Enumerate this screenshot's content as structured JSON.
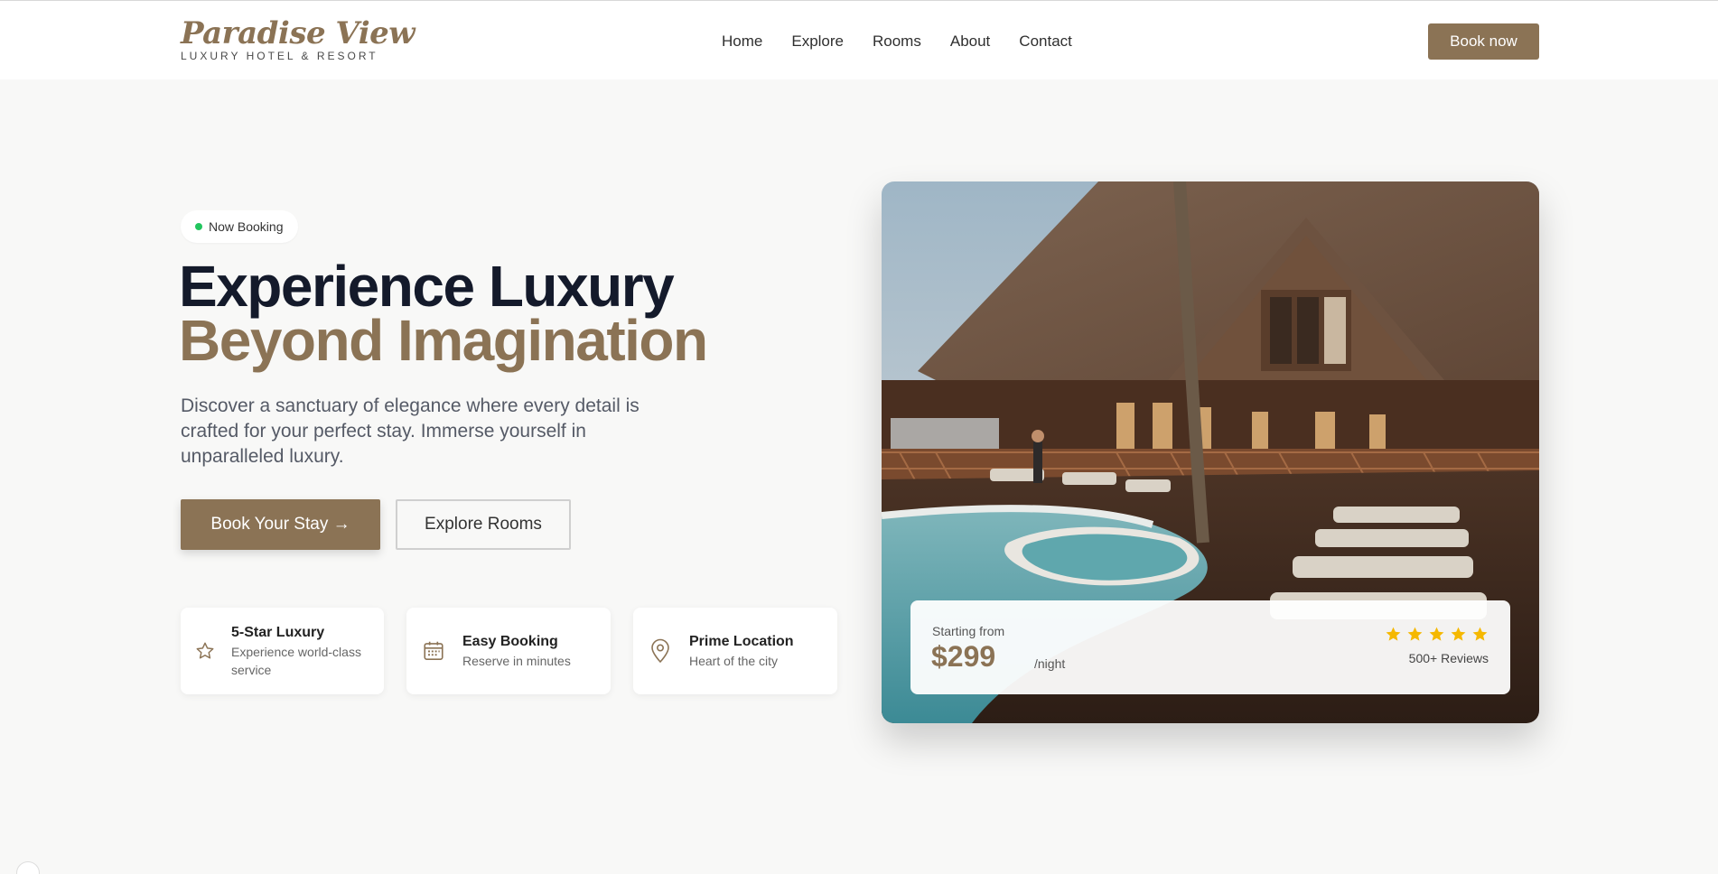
{
  "brand": {
    "name": "Paradise View",
    "tagline": "LUXURY HOTEL & RESORT"
  },
  "nav": {
    "items": [
      {
        "label": "Home"
      },
      {
        "label": "Explore"
      },
      {
        "label": "Rooms"
      },
      {
        "label": "About"
      },
      {
        "label": "Contact"
      }
    ]
  },
  "header": {
    "book_label": "Book now"
  },
  "hero": {
    "badge": "Now Booking",
    "title_line1": "Experience Luxury",
    "title_line2": "Beyond Imagination",
    "lead": "Discover a sanctuary of elegance where every detail is crafted for your perfect stay. Immerse yourself in unparalleled luxury.",
    "primary_cta": "Book Your Stay →",
    "secondary_cta": "Explore Rooms"
  },
  "features": [
    {
      "title": "5-Star Luxury",
      "desc": "Experience world-class service",
      "icon": "star-icon"
    },
    {
      "title": "Easy Booking",
      "desc": "Reserve in minutes",
      "icon": "calendar-icon"
    },
    {
      "title": "Prime Location",
      "desc": "Heart of the city",
      "icon": "location-pin-icon"
    }
  ],
  "pricing": {
    "label": "Starting from",
    "price": "$299",
    "unit": "/night",
    "rating": 5,
    "reviews": "500+ Reviews"
  },
  "colors": {
    "accent": "#8b7355",
    "star": "#f5b800",
    "badge_dot": "#22c55e"
  }
}
